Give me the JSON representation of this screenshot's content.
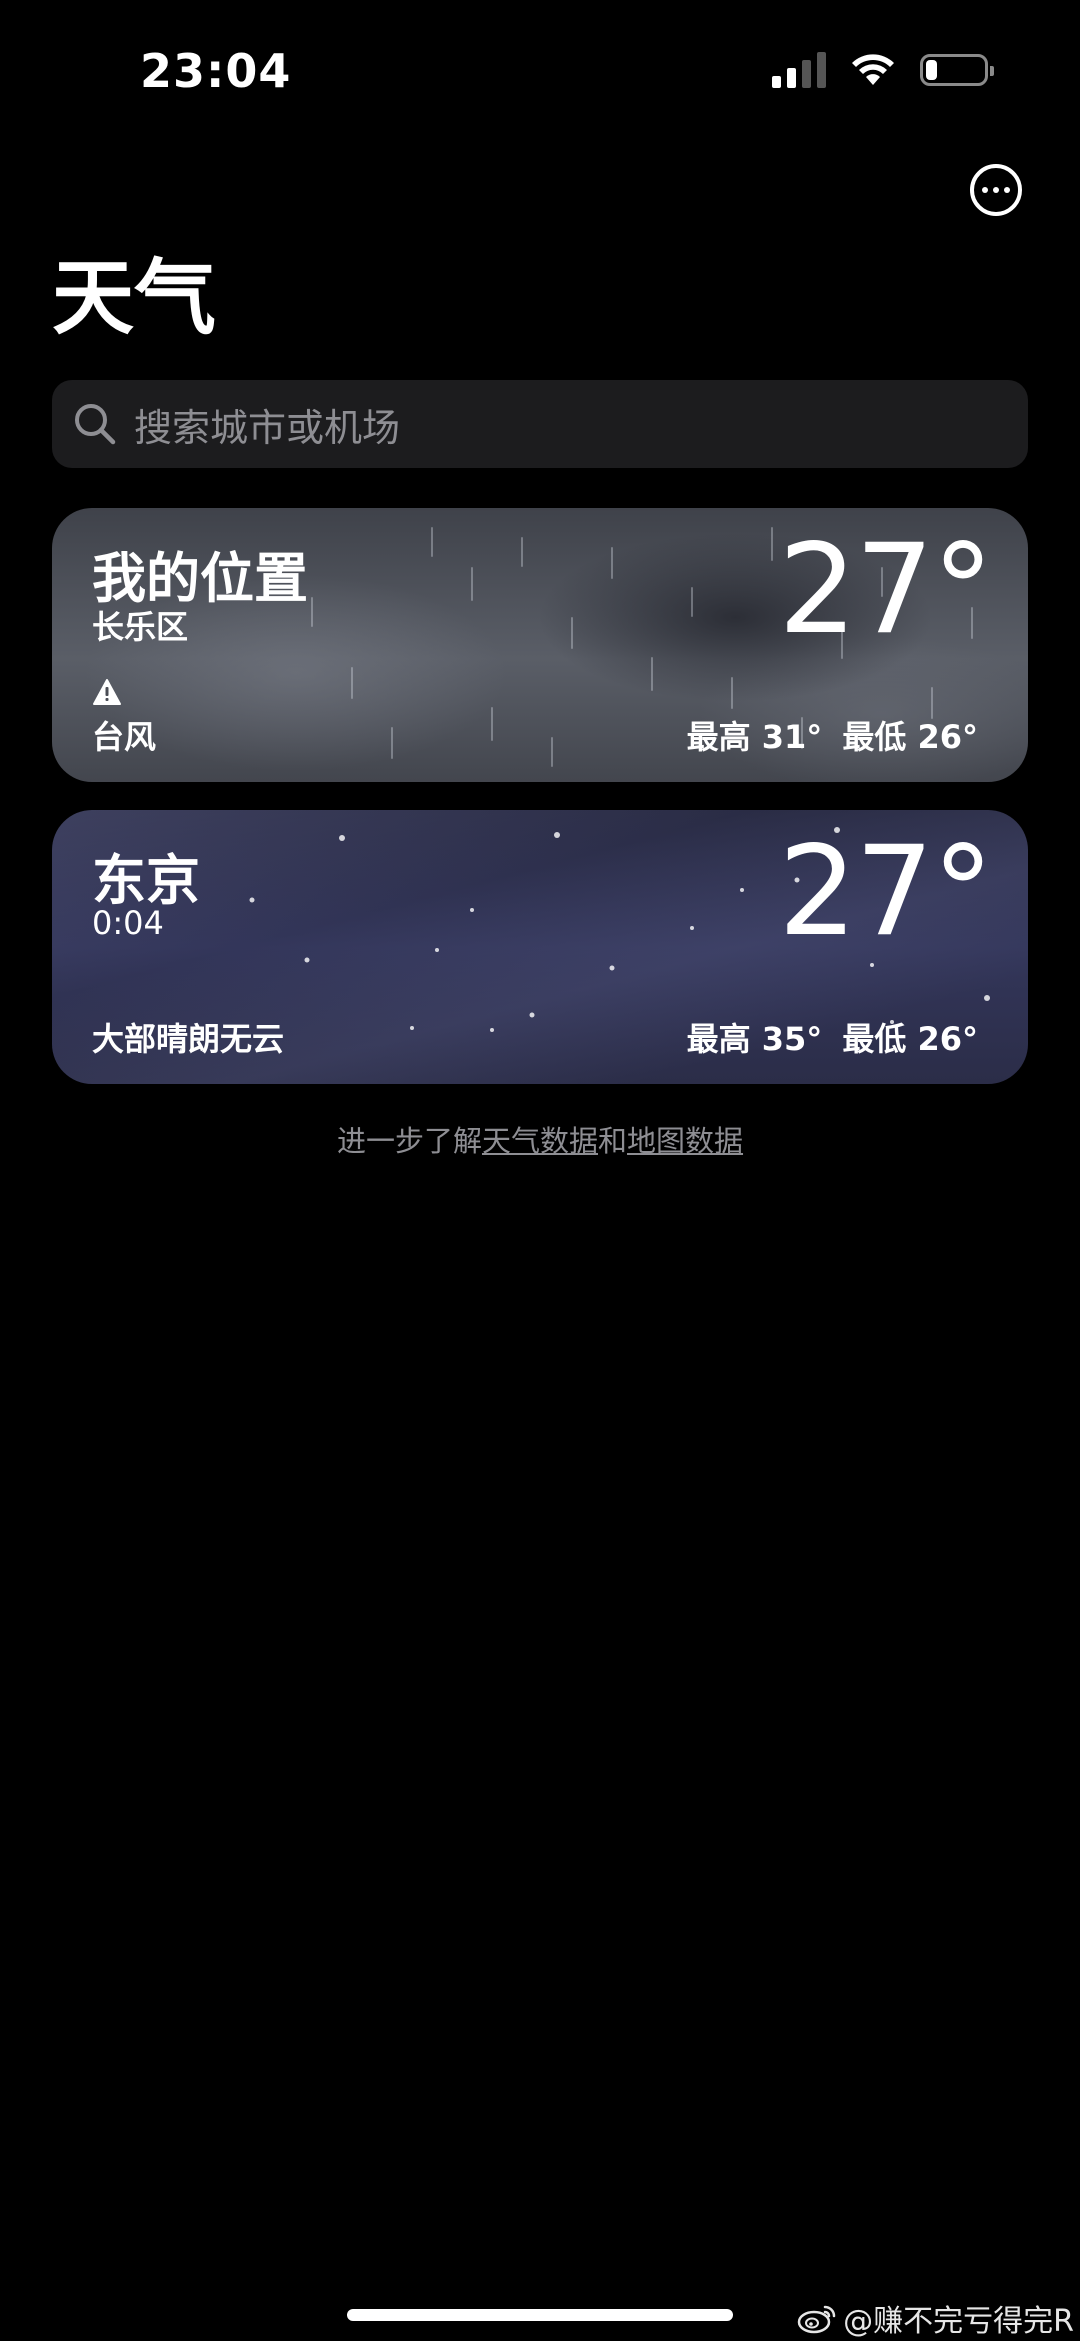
{
  "status_bar": {
    "time": "23:04",
    "signal_bars_on": 2,
    "signal_bars_total": 4,
    "battery_level": 0.2
  },
  "header": {
    "title": "天气"
  },
  "search": {
    "placeholder": "搜索城市或机场"
  },
  "cities": [
    {
      "name": "我的位置",
      "subtitle": "长乐区",
      "temperature": "27°",
      "condition": "台风",
      "alert_icon": "warning-triangle-icon",
      "high": "最高 31°",
      "low": "最低 26°",
      "background": "rain"
    },
    {
      "name": "东京",
      "subtitle": "0:04",
      "temperature": "27°",
      "condition": "大部晴朗无云",
      "high": "最高 35°",
      "low": "最低 26°",
      "background": "clear-night"
    }
  ],
  "footer": {
    "prefix": "进一步了解",
    "weather_data_link": "天气数据",
    "conjunction": "和",
    "map_data_link": "地图数据"
  },
  "watermark": {
    "text": "@赚不完亏得完R",
    "logo": "weibo-icon"
  }
}
